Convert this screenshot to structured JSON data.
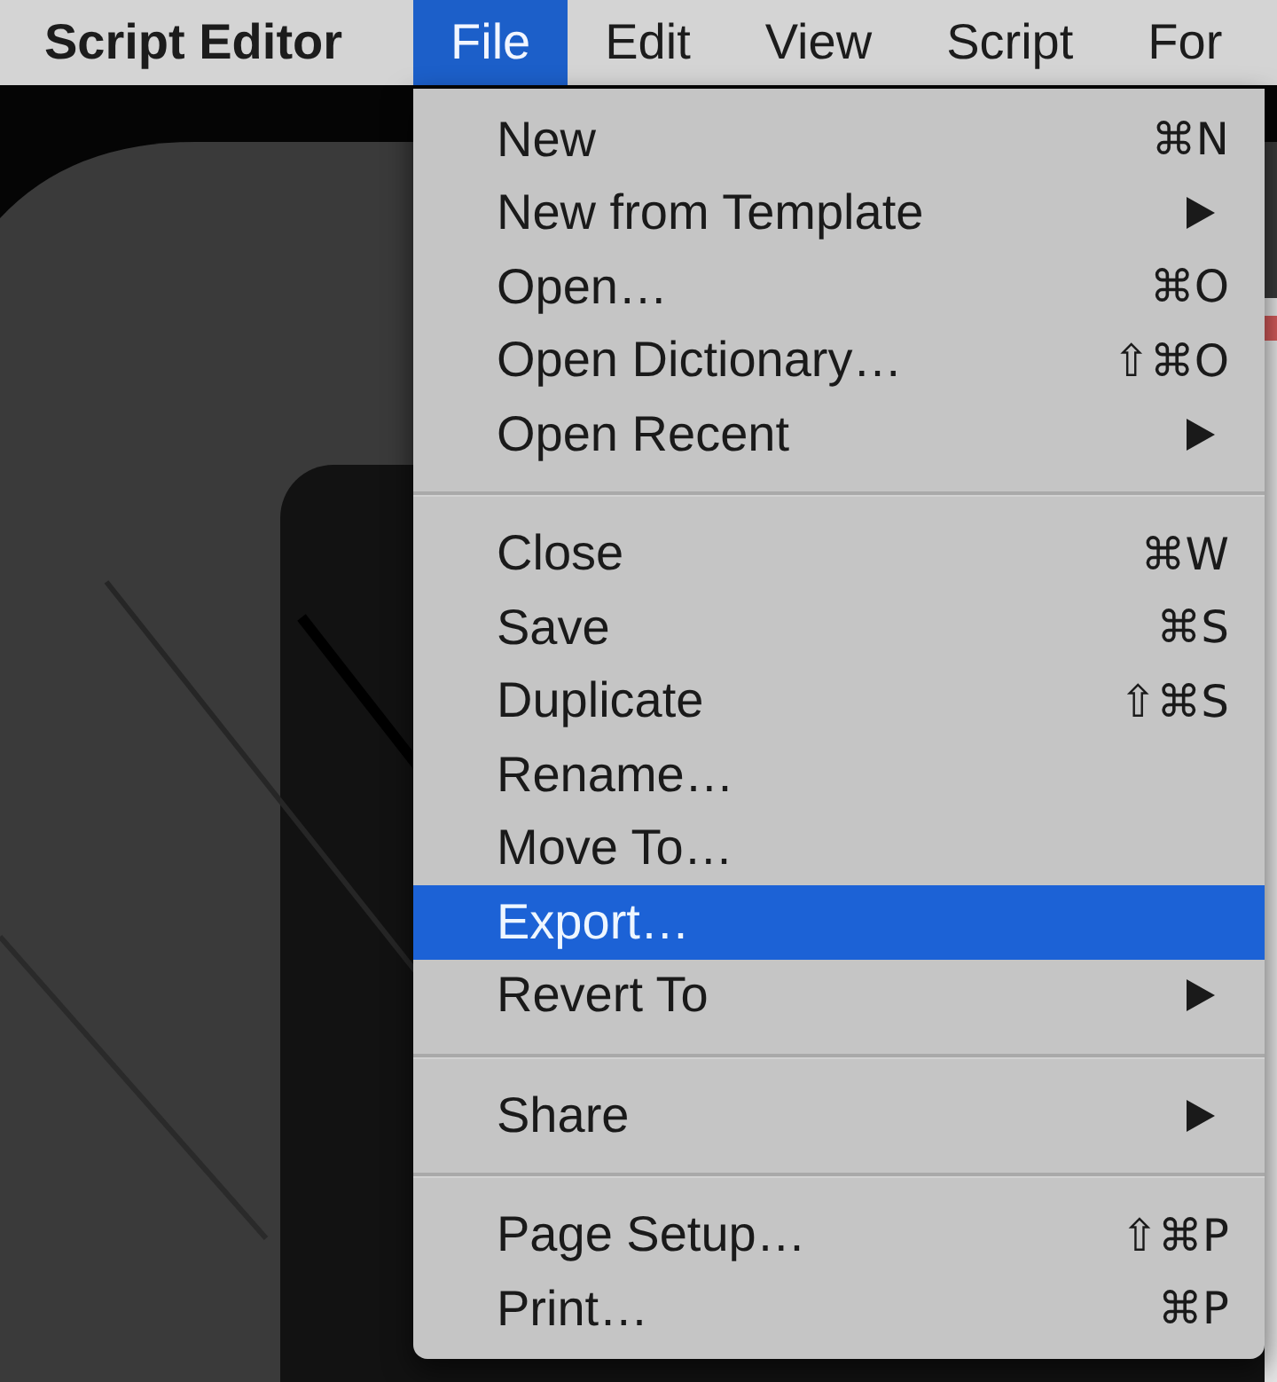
{
  "menu_bar": {
    "app_name": "Script Editor",
    "menus": [
      {
        "label": "File",
        "selected": true
      },
      {
        "label": "Edit",
        "selected": false
      },
      {
        "label": "View",
        "selected": false
      },
      {
        "label": "Script",
        "selected": false
      },
      {
        "label": "For",
        "selected": false
      }
    ]
  },
  "file_menu": {
    "sections": [
      {
        "items": [
          {
            "label": "New",
            "shortcut": "⌘N",
            "submenu": false,
            "selected": false
          },
          {
            "label": "New from Template",
            "submenu": true,
            "selected": false
          },
          {
            "label": "Open…",
            "shortcut": "⌘O",
            "submenu": false,
            "selected": false
          },
          {
            "label": "Open Dictionary…",
            "shortcut": "⇧⌘O",
            "submenu": false,
            "selected": false
          },
          {
            "label": "Open Recent",
            "submenu": true,
            "selected": false
          }
        ]
      },
      {
        "items": [
          {
            "label": "Close",
            "shortcut": "⌘W",
            "submenu": false,
            "selected": false
          },
          {
            "label": "Save",
            "shortcut": "⌘S",
            "submenu": false,
            "selected": false
          },
          {
            "label": "Duplicate",
            "shortcut": "⇧⌘S",
            "submenu": false,
            "selected": false
          },
          {
            "label": "Rename…",
            "submenu": false,
            "selected": false
          },
          {
            "label": "Move To…",
            "submenu": false,
            "selected": false
          },
          {
            "label": "Export…",
            "submenu": false,
            "selected": true
          },
          {
            "label": "Revert To",
            "submenu": true,
            "selected": false
          }
        ]
      },
      {
        "items": [
          {
            "label": "Share",
            "submenu": true,
            "selected": false
          }
        ]
      },
      {
        "items": [
          {
            "label": "Page Setup…",
            "shortcut": "⇧⌘P",
            "submenu": false,
            "selected": false
          },
          {
            "label": "Print…",
            "shortcut": "⌘P",
            "submenu": false,
            "selected": false
          }
        ]
      }
    ]
  }
}
